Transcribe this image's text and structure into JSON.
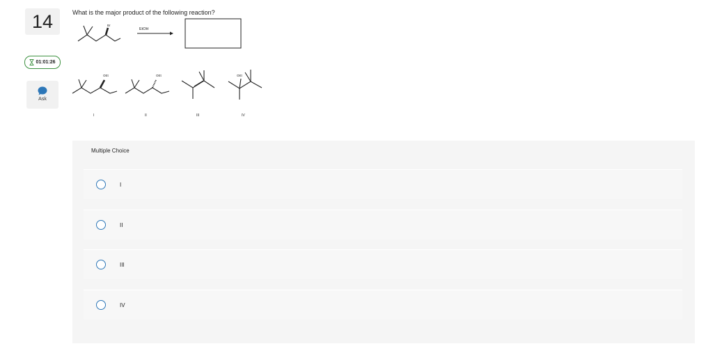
{
  "question": {
    "number": "14",
    "text": "What is the major product of the following reaction?",
    "reagent": "EtOH",
    "substituent_br": "Br"
  },
  "timer": {
    "value": "01:01:26",
    "icon": "hourglass-icon"
  },
  "ask": {
    "label": "Ask",
    "icon": "chat-bubble-icon"
  },
  "structures": {
    "labels": [
      "I",
      "II",
      "III",
      "IV"
    ],
    "substituent": "OEt"
  },
  "multiple_choice": {
    "title": "Multiple Choice",
    "options": [
      {
        "label": "I"
      },
      {
        "label": "II"
      },
      {
        "label": "III"
      },
      {
        "label": "IV"
      }
    ]
  },
  "colors": {
    "accent": "#2d77b8",
    "timer_border": "#3d9140",
    "panel": "#f5f5f5"
  }
}
